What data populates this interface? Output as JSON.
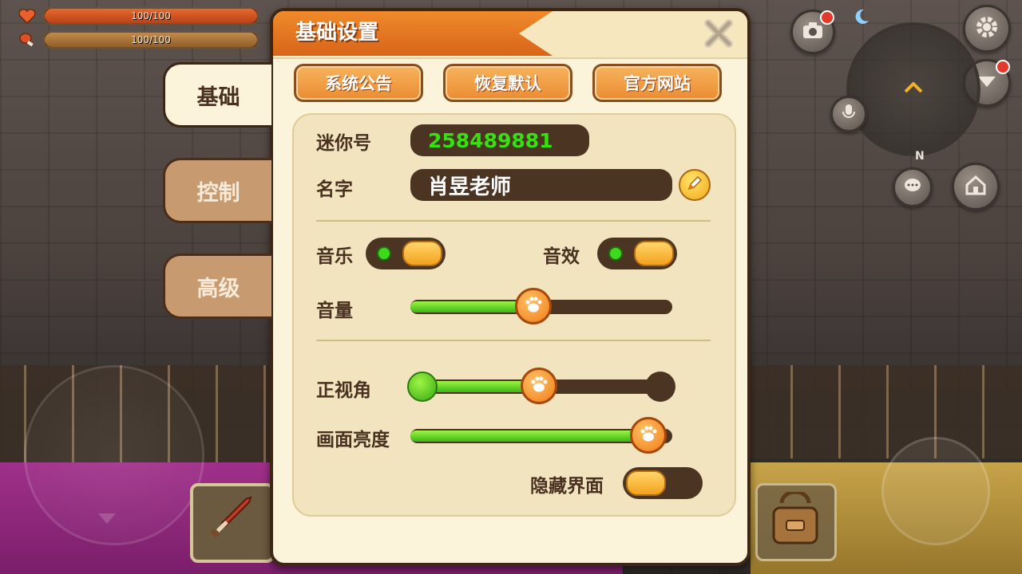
{
  "hud": {
    "health_text": "100/100",
    "hunger_text": "100/100",
    "health_level": 1.0,
    "hunger_level": 1.0,
    "compass_label": "N"
  },
  "panel": {
    "title": "基础设置",
    "tabs": [
      {
        "label": "基础",
        "active": true
      },
      {
        "label": "控制",
        "active": false
      },
      {
        "label": "高级",
        "active": false
      }
    ],
    "buttons": {
      "announcement": "系统公告",
      "restore_default": "恢复默认",
      "official_site": "官方网站"
    },
    "mini_id_label": "迷你号",
    "mini_id_value": "258489881",
    "name_label": "名字",
    "name_value": "肖昱老师",
    "music_label": "音乐",
    "music_on": true,
    "sfx_label": "音效",
    "sfx_on": true,
    "volume_label": "音量",
    "volume_level": 0.47,
    "fov_label": "正视角",
    "fov_level": 0.49,
    "brightness_label": "画面亮度",
    "brightness_level": 0.91,
    "hide_ui_label": "隐藏界面",
    "hide_ui_on": false
  },
  "colors": {
    "accent_orange": "#f08a2b",
    "panel_bg": "#fbf3da",
    "id_green": "#37e012",
    "dark_brown": "#4c3423"
  }
}
